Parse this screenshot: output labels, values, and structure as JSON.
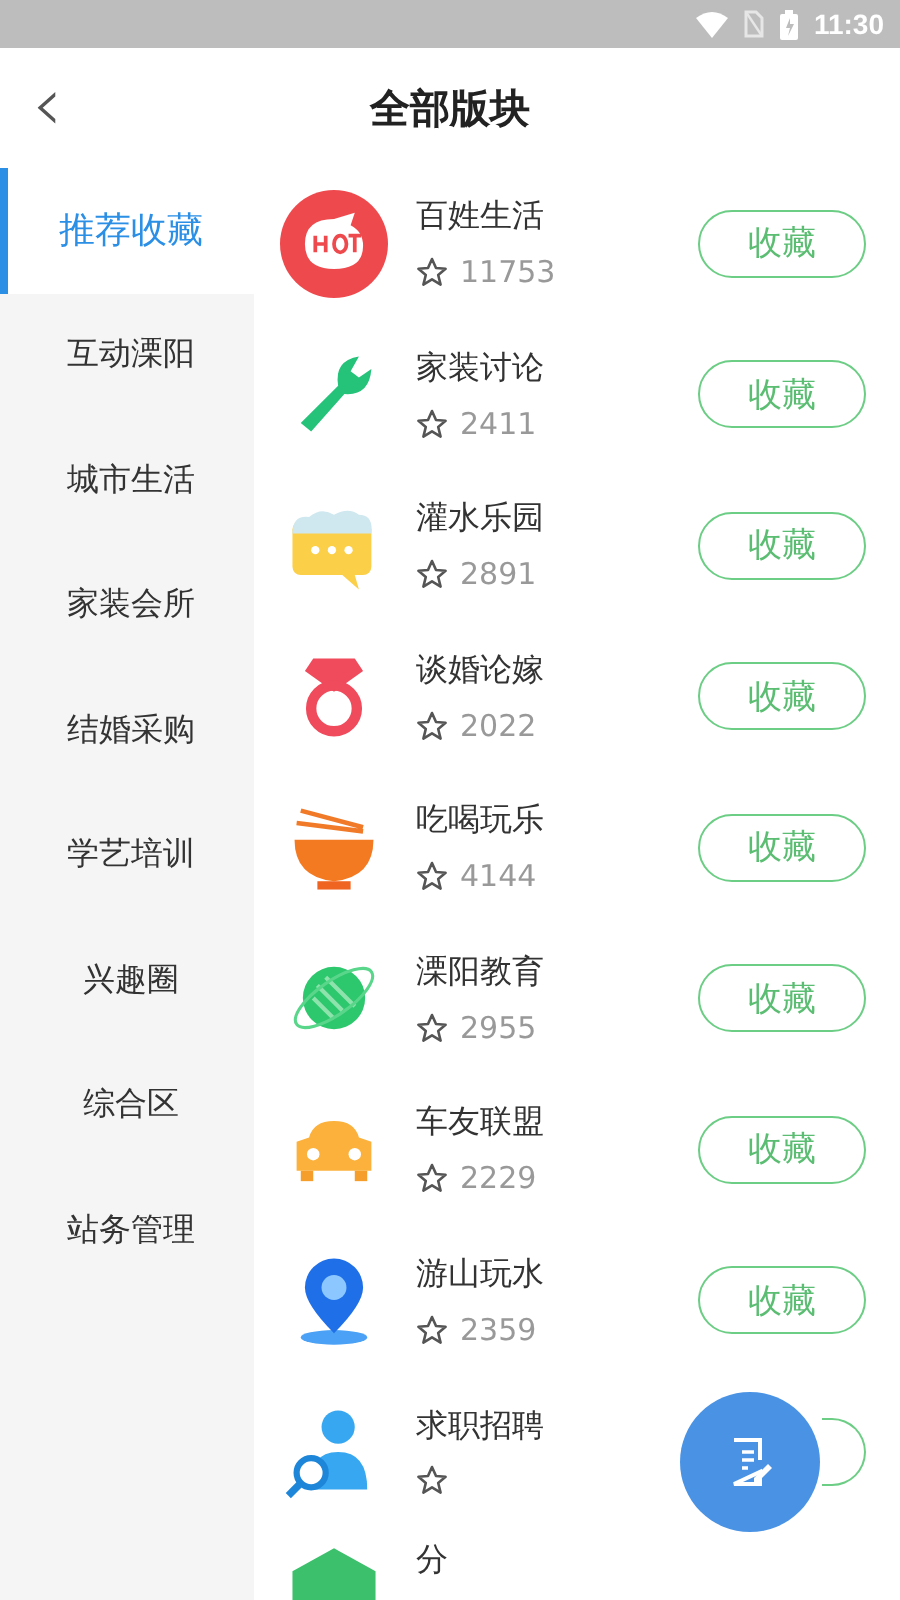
{
  "status_bar": {
    "time": "11:30"
  },
  "header": {
    "back": "‹",
    "title": "全部版块"
  },
  "sidebar": {
    "items": [
      {
        "label": "推荐收藏",
        "selected": true
      },
      {
        "label": "互动溧阳",
        "selected": false
      },
      {
        "label": "城市生活",
        "selected": false
      },
      {
        "label": "家装会所",
        "selected": false
      },
      {
        "label": "结婚采购",
        "selected": false
      },
      {
        "label": "学艺培训",
        "selected": false
      },
      {
        "label": "兴趣圈",
        "selected": false
      },
      {
        "label": "综合区",
        "selected": false
      },
      {
        "label": "站务管理",
        "selected": false
      }
    ]
  },
  "boards": [
    {
      "name": "百姓生活",
      "count": "11753",
      "button": "收藏"
    },
    {
      "name": "家装讨论",
      "count": "2411",
      "button": "收藏"
    },
    {
      "name": "灌水乐园",
      "count": "2891",
      "button": "收藏"
    },
    {
      "name": "谈婚论嫁",
      "count": "2022",
      "button": "收藏"
    },
    {
      "name": "吃喝玩乐",
      "count": "4144",
      "button": "收藏"
    },
    {
      "name": "溧阳教育",
      "count": "2955",
      "button": "收藏"
    },
    {
      "name": "车友联盟",
      "count": "2229",
      "button": "收藏"
    },
    {
      "name": "游山玩水",
      "count": "2359",
      "button": "收藏"
    },
    {
      "name": "求职招聘"
    },
    {
      "name": "分"
    }
  ],
  "fab": {
    "kind": "post"
  }
}
